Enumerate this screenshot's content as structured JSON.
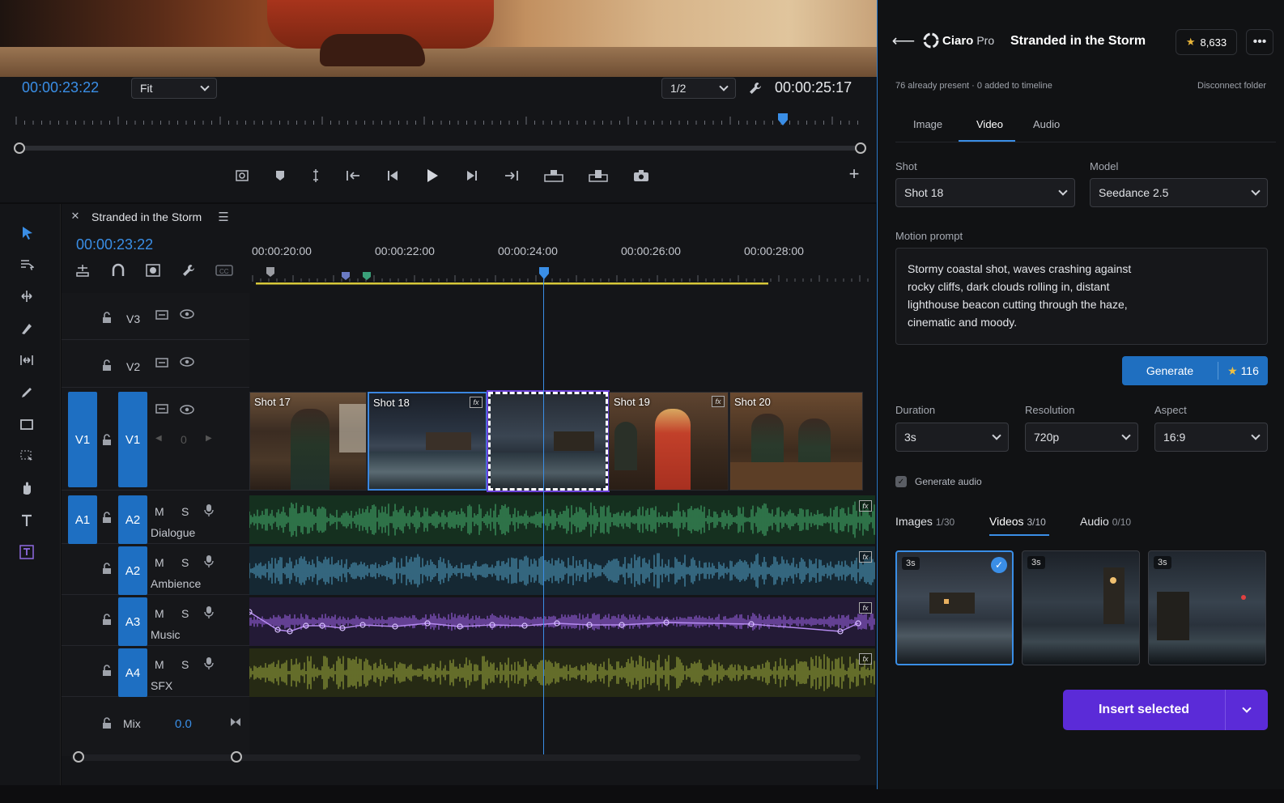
{
  "monitor": {
    "current_timecode": "00:00:23:22",
    "fit_label": "Fit",
    "resolution_label": "1/2",
    "duration_timecode": "00:00:25:17",
    "transport_icons": [
      "export-frame-icon",
      "marker-icon",
      "mark-in-out-icon",
      "go-to-in-icon",
      "step-back-icon",
      "play-icon",
      "step-forward-icon",
      "go-to-out-icon",
      "insert-icon",
      "overwrite-icon",
      "camera-icon"
    ],
    "playhead_position_fraction": 0.9
  },
  "tools": [
    "selection-tool-icon",
    "track-select-icon",
    "ripple-edit-icon",
    "razor-icon",
    "slip-icon",
    "pen-icon",
    "rectangle-icon",
    "hand-select-icon",
    "hand-icon",
    "type-icon",
    "caption-icon"
  ],
  "sequence": {
    "name": "Stranded in the Storm",
    "timecode": "00:00:23:22",
    "ruler_ticks": [
      "00:00:20:00",
      "00:00:22:00",
      "00:00:24:00",
      "00:00:26:00",
      "00:00:28:00"
    ],
    "video_tracks": [
      {
        "label": "V3"
      },
      {
        "label": "V2"
      },
      {
        "label": "V1",
        "source": "V1",
        "counter": "0"
      }
    ],
    "clips": [
      {
        "name": "Shot 17"
      },
      {
        "name": "Shot 18",
        "fx": "fx"
      },
      {
        "name": ""
      },
      {
        "name": "Shot 19",
        "fx": "fx"
      },
      {
        "name": "Shot 20"
      }
    ],
    "audio_tracks": [
      {
        "source": "A1",
        "label": "A2",
        "name": "Dialogue",
        "m": "M",
        "s": "S",
        "color": "#3f9e63"
      },
      {
        "label": "A2",
        "name": "Ambience",
        "m": "M",
        "s": "S",
        "color": "#4a8fb0"
      },
      {
        "label": "A3",
        "name": "Music",
        "m": "M",
        "s": "S",
        "color": "#8e5bd0"
      },
      {
        "label": "A4",
        "name": "SFX",
        "m": "M",
        "s": "S",
        "color": "#8e9a3a"
      }
    ],
    "mix_label": "Mix",
    "mix_value": "0.0"
  },
  "panel": {
    "brand": "Ciaro",
    "brand_suffix": "Pro",
    "title": "Stranded in the Storm",
    "credits": "8,633",
    "status": "76 already present · 0 added to timeline",
    "disconnect": "Disconnect folder",
    "tabs": [
      "Image",
      "Video",
      "Audio"
    ],
    "active_tab": "Video",
    "shot_label": "Shot",
    "shot_value": "Shot 18",
    "model_label": "Model",
    "model_value": "Seedance 2.5",
    "prompt_label": "Motion prompt",
    "prompt_text": "Stormy coastal shot, waves crashing against rocky cliffs, dark clouds rolling in, distant lighthouse beacon cutting through the haze, cinematic and moody.",
    "generate_label": "Generate",
    "generate_cost": "116",
    "duration_label": "Duration",
    "duration_value": "3s",
    "resolution_label": "Resolution",
    "resolution_value": "720p",
    "aspect_label": "Aspect",
    "aspect_value": "16:9",
    "audio_checkbox": "Generate audio",
    "media_tabs": [
      {
        "label": "Images",
        "count": "1/30"
      },
      {
        "label": "Videos",
        "count": "3/10"
      },
      {
        "label": "Audio",
        "count": "0/10"
      }
    ],
    "thumbs": [
      {
        "duration": "3s",
        "selected": true
      },
      {
        "duration": "3s",
        "selected": false
      },
      {
        "duration": "3s",
        "selected": false
      }
    ],
    "insert_label": "Insert selected"
  }
}
